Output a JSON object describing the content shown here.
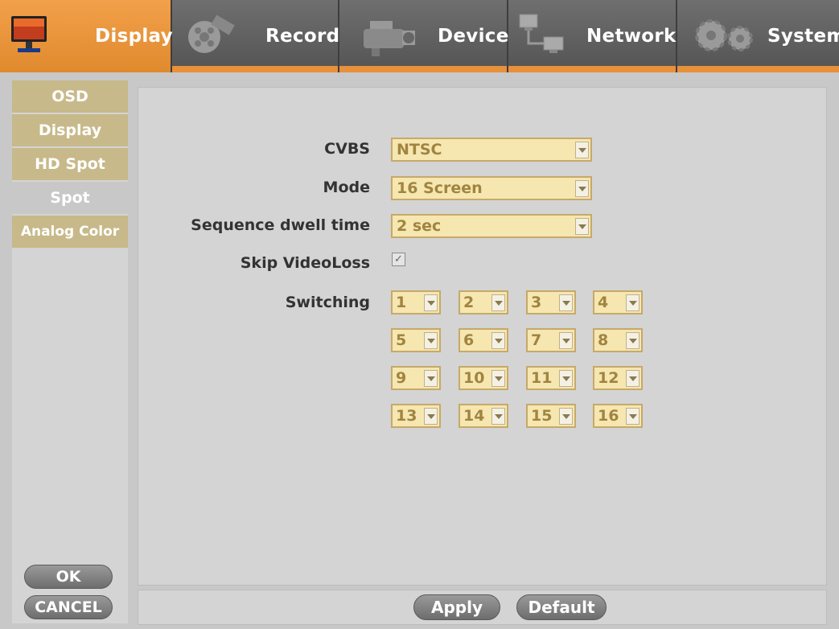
{
  "tabs": [
    {
      "label": "Display",
      "icon": "monitor-icon",
      "active": true
    },
    {
      "label": "Record",
      "icon": "film-reel-icon",
      "active": false
    },
    {
      "label": "Device",
      "icon": "camera-icon",
      "active": false
    },
    {
      "label": "Network",
      "icon": "network-icon",
      "active": false
    },
    {
      "label": "System",
      "icon": "gears-icon",
      "active": false
    }
  ],
  "sidebar": {
    "items": [
      {
        "label": "OSD"
      },
      {
        "label": "Display"
      },
      {
        "label": "HD Spot"
      },
      {
        "label": "Spot"
      },
      {
        "label": "Analog Color"
      }
    ],
    "active": "Spot",
    "ok_label": "OK",
    "cancel_label": "CANCEL"
  },
  "form": {
    "cvbs": {
      "label": "CVBS",
      "value": "NTSC"
    },
    "mode": {
      "label": "Mode",
      "value": "16 Screen"
    },
    "dwell": {
      "label": "Sequence dwell time",
      "value": "2 sec"
    },
    "skip": {
      "label": "Skip VideoLoss",
      "checked": true
    },
    "switching": {
      "label": "Switching",
      "values": [
        "1",
        "2",
        "3",
        "4",
        "5",
        "6",
        "7",
        "8",
        "9",
        "10",
        "11",
        "12",
        "13",
        "14",
        "15",
        "16"
      ]
    }
  },
  "footer": {
    "apply_label": "Apply",
    "default_label": "Default"
  },
  "colors": {
    "accent": "#e8903a",
    "sidebar_item": "#c7b98a",
    "field_bg": "#f6e6b0",
    "field_text": "#a08440"
  }
}
